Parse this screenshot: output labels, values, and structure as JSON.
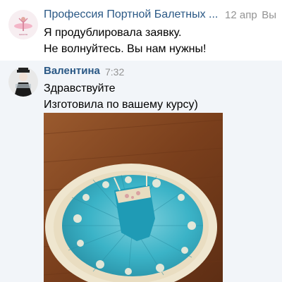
{
  "messages": [
    {
      "sender": "Профессия Портной Балетных ...",
      "time": "12 апр",
      "read_mark": "Вы",
      "lines": [
        "Я продублировала заявку.",
        "Не волнуйтесь. Вы нам нужны!"
      ]
    },
    {
      "sender": "Валентина",
      "time": "7:32",
      "lines": [
        "Здравствуйте",
        "Изготовила по вашему курсу)"
      ]
    }
  ],
  "colors": {
    "link": "#2a5885",
    "muted": "#939393",
    "tutu": "#3bb3c7",
    "lace": "#efe6cf",
    "floor": "#8a4a22"
  }
}
